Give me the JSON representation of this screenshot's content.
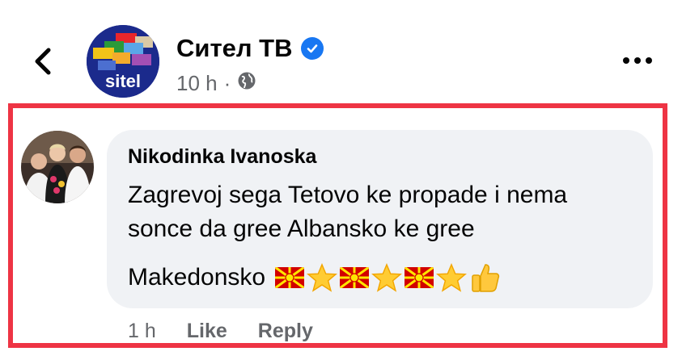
{
  "header": {
    "page_name": "Ситeл ТВ",
    "time": "10 h",
    "separator": "·",
    "logo_text": "sitel"
  },
  "comment": {
    "author": "Nikodinka Ivanoska",
    "lines": [
      "Zagrevoj sega Tetovo ke propade i nema",
      "sonce da gree Albansko ke gree",
      "Makedonsko"
    ],
    "emojis": [
      "mk-flag",
      "star",
      "mk-flag",
      "star",
      "mk-flag",
      "star",
      "thumbs-up"
    ],
    "time": "1 h",
    "like_label": "Like",
    "reply_label": "Reply"
  },
  "colors": {
    "highlight": "#ee3444",
    "verified": "#1877f2",
    "bubble": "#f0f2f5",
    "secondary_text": "#65676b"
  }
}
